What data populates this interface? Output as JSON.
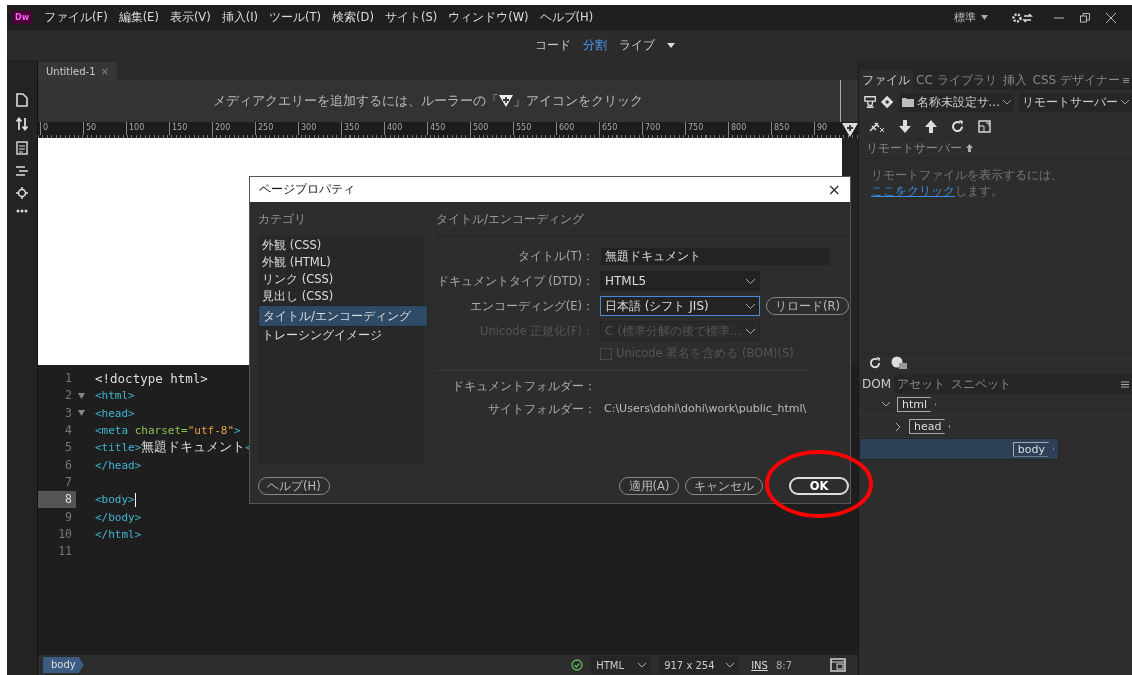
{
  "app_logo": "Dw",
  "menu": [
    "ファイル(F)",
    "編集(E)",
    "表示(V)",
    "挿入(I)",
    "ツール(T)",
    "検索(D)",
    "サイト(S)",
    "ウィンドウ(W)",
    "ヘルプ(H)"
  ],
  "workspace": "標準",
  "view_modes": [
    {
      "label": "コード",
      "selected": false
    },
    {
      "label": "分割",
      "selected": true
    },
    {
      "label": "ライブ",
      "selected": false
    }
  ],
  "document_tabs": [
    {
      "label": "Untitled-1",
      "close": "×"
    }
  ],
  "media_query_hint": {
    "before": "メディアクエリーを追加するには、ルーラーの「",
    "after": "」アイコンをクリック"
  },
  "ruler_labels": [
    "0",
    "50",
    "100",
    "150",
    "200",
    "250",
    "300",
    "350",
    "400",
    "450",
    "500",
    "550",
    "600",
    "650",
    "700",
    "750",
    "800",
    "850",
    "90"
  ],
  "code_lines": [
    {
      "number": "1",
      "foldable": false,
      "current": false,
      "tokens": [
        {
          "kind": "text",
          "text": "<!doctype html>"
        }
      ]
    },
    {
      "number": "2",
      "foldable": true,
      "current": false,
      "tokens": [
        {
          "kind": "tag",
          "text": "<html>"
        }
      ]
    },
    {
      "number": "3",
      "foldable": true,
      "current": false,
      "tokens": [
        {
          "kind": "tag",
          "text": "<head>"
        }
      ]
    },
    {
      "number": "4",
      "foldable": false,
      "current": false,
      "tokens": [
        {
          "kind": "tag",
          "text": "<meta"
        },
        {
          "kind": "attr",
          "text": " charset="
        },
        {
          "kind": "string",
          "text": "\"utf-8\""
        },
        {
          "kind": "tag",
          "text": ">"
        }
      ]
    },
    {
      "number": "5",
      "foldable": false,
      "current": false,
      "tokens": [
        {
          "kind": "tag",
          "text": "<title>"
        },
        {
          "kind": "text",
          "text": "無題ドキュメント"
        },
        {
          "kind": "tag",
          "text": "<"
        }
      ]
    },
    {
      "number": "6",
      "foldable": false,
      "current": false,
      "tokens": [
        {
          "kind": "tag",
          "text": "</head>"
        }
      ]
    },
    {
      "number": "7",
      "foldable": false,
      "current": false
    },
    {
      "number": "8",
      "foldable": false,
      "current": true,
      "tokens": [
        {
          "kind": "tag",
          "text": "<body>"
        }
      ]
    },
    {
      "number": "9",
      "foldable": false,
      "current": false,
      "tokens": [
        {
          "kind": "tag",
          "text": "</body>"
        }
      ]
    },
    {
      "number": "10",
      "foldable": false,
      "current": false,
      "tokens": [
        {
          "kind": "tag",
          "text": "</html>"
        }
      ]
    },
    {
      "number": "11",
      "foldable": false,
      "current": false
    }
  ],
  "status_bar": {
    "tag": "body",
    "language": "HTML",
    "size": "917 x 254",
    "mode": "INS",
    "position": "8:7"
  },
  "files_panel": {
    "tabs": [
      {
        "label": "ファイル",
        "selected": true
      },
      {
        "label": "CC ライブラリ",
        "selected": false
      },
      {
        "label": "挿入",
        "selected": false
      },
      {
        "label": "CSS デザイナー",
        "selected": false
      }
    ],
    "site": "名称未設定サ...",
    "server": "リモートサーバー",
    "remote_header": "リモートサーバー",
    "message": {
      "before": "リモートファイルを表示するには、",
      "link": "ここをクリック",
      "after": "します。"
    }
  },
  "dom_panel": {
    "tabs": [
      {
        "label": "DOM",
        "selected": true
      },
      {
        "label": "アセット",
        "selected": false
      },
      {
        "label": "スニペット",
        "selected": false
      }
    ],
    "tree": [
      {
        "tag": "html",
        "expanded": true,
        "selected": false,
        "children": [
          {
            "tag": "head",
            "expanded": false,
            "selected": false
          },
          {
            "tag": "body",
            "selected": true
          }
        ]
      }
    ]
  },
  "dialog": {
    "title": "ページプロパティ",
    "close": "×",
    "category_label": "カテゴリ",
    "categories": [
      {
        "label": "外観 (CSS)",
        "selected": false
      },
      {
        "label": "外観 (HTML)",
        "selected": false
      },
      {
        "label": "リンク (CSS)",
        "selected": false
      },
      {
        "label": "見出し (CSS)",
        "selected": false
      },
      {
        "label": "タイトル/エンコーディング",
        "selected": true
      },
      {
        "label": "トレーシングイメージ",
        "selected": false
      }
    ],
    "section_title": "タイトル/エンコーディング",
    "fields": [
      {
        "kind": "text",
        "label": "タイトル(T)：",
        "value": "無題ドキュメント",
        "focused": false,
        "disabled": false
      },
      {
        "kind": "select",
        "label": "ドキュメントタイプ (DTD)：",
        "value": "HTML5",
        "focused": false,
        "disabled": false
      },
      {
        "kind": "select",
        "label": "エンコーディング(E)：",
        "value": "日本語 (シフト JIS)",
        "focused": true,
        "disabled": false,
        "button": "リロード(R)"
      },
      {
        "kind": "select",
        "label": "Unicode 正規化(F)：",
        "value": "C (標準分解の後で標準...",
        "focused": false,
        "disabled": true
      },
      {
        "kind": "checkbox",
        "label": "Unicode 署名を含める (BOM)(S)",
        "checked": false,
        "focused": false,
        "disabled": true
      }
    ],
    "document_folder_label": "ドキュメントフォルダー：",
    "site_folder_label": "サイトフォルダー：",
    "site_folder": "C:\\Users\\dohi\\dohi\\work\\public_html\\",
    "help_button": "ヘルプ(H)",
    "buttons": [
      {
        "label": "適用(A)",
        "default": false
      },
      {
        "label": "キャンセル",
        "default": false
      },
      {
        "label": "OK",
        "default": true
      }
    ]
  }
}
